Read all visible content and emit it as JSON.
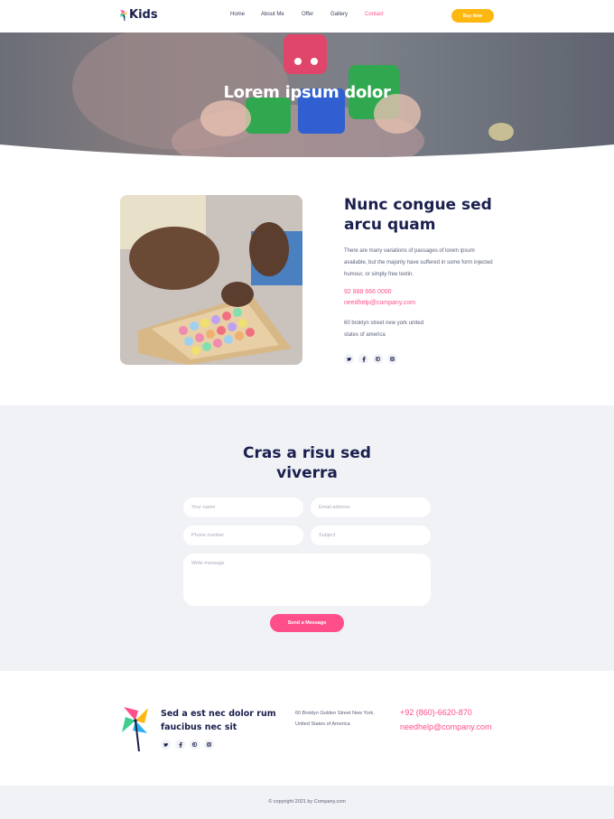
{
  "header": {
    "logo_text": "Kids",
    "nav": [
      {
        "label": "Home",
        "active": false
      },
      {
        "label": "About Me",
        "active": false
      },
      {
        "label": "Offer",
        "active": false
      },
      {
        "label": "Gallery",
        "active": false
      },
      {
        "label": "Contact",
        "active": true
      }
    ],
    "buy_button": "Buy Now"
  },
  "hero": {
    "title": "Lorem ipsum dolor"
  },
  "about": {
    "heading": "Nunc congue sed arcu quam",
    "text": "There are many variations of passages of lorem ipsum available, but the majority have suffered in some form injected humour, or simply free textin.",
    "phone": "92 888 666 0000",
    "email": "needhelp@company.com",
    "address_line1": "60 broklyn street new york united",
    "address_line2": "states of america",
    "social": [
      "twitter-icon",
      "facebook-icon",
      "pinterest-icon",
      "instagram-icon"
    ]
  },
  "contact": {
    "heading_line1": "Cras a risu sed",
    "heading_line2": "viverra",
    "name_placeholder": "Your name",
    "email_placeholder": "Email address",
    "phone_placeholder": "Phone number",
    "subject_placeholder": "Subject",
    "message_placeholder": "Write message",
    "send_button": "Send a Message"
  },
  "footer": {
    "heading": "Sed a est nec dolor rum faucibus nec sit",
    "address_line1": "60 Broklyn Golden Street New York.",
    "address_line2": "United States of America",
    "phone": "+92 (860)-6620-870",
    "email": "needhelp@company.com",
    "social": [
      "twitter-icon",
      "facebook-icon",
      "pinterest-icon",
      "instagram-icon"
    ],
    "copyright": "© copyright 2021 by Company.com"
  },
  "colors": {
    "accent_pink": "#ff4f8b",
    "accent_yellow": "#fcb711",
    "navy": "#1a1f4e",
    "light_bg": "#f0f2f5"
  }
}
